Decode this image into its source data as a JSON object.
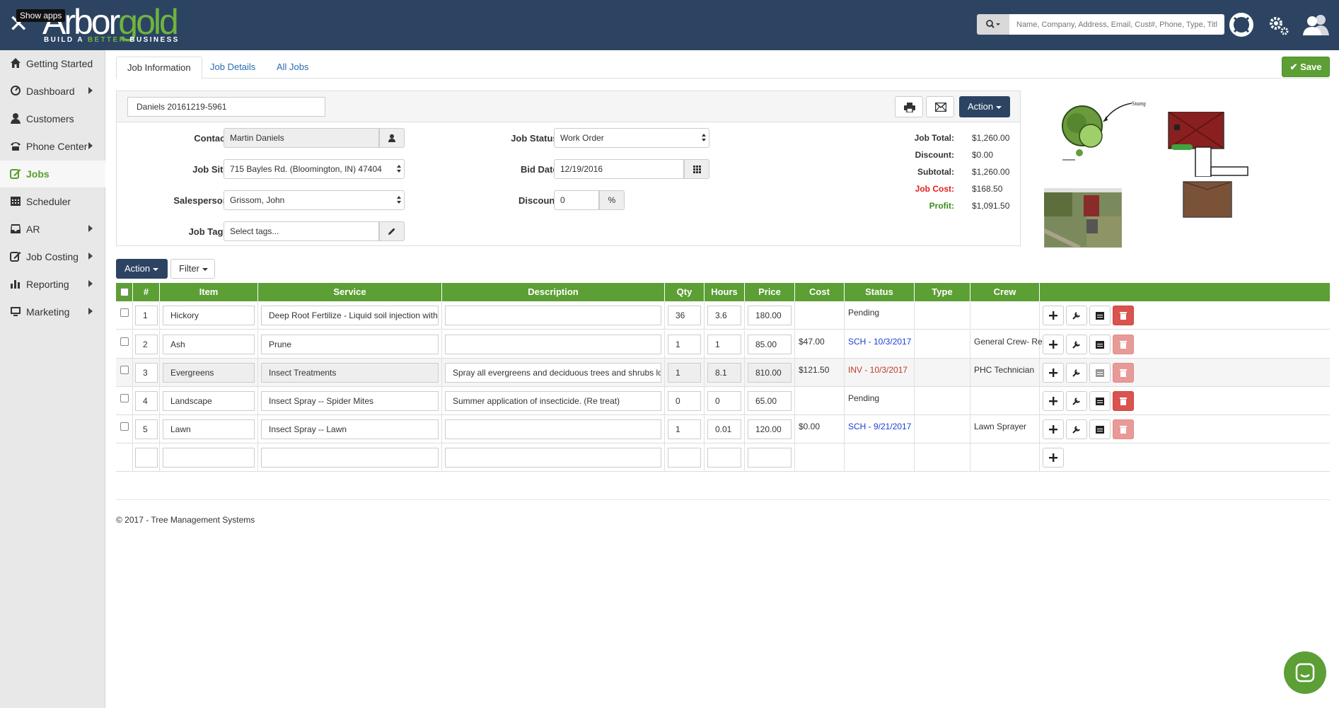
{
  "topbar": {
    "show_apps": "Show apps",
    "logo_main_a": "Arbor",
    "logo_main_b": "gold",
    "logo_tag_a": "BUILD A",
    "logo_tag_b": "BETTER",
    "logo_tag_c": "BUSINESS",
    "search_placeholder": "Name, Company, Address, Email, Cust#, Phone, Type, Title"
  },
  "sidebar": {
    "items": [
      {
        "label": "Getting Started",
        "icon": "home-icon"
      },
      {
        "label": "Dashboard",
        "icon": "dashboard-icon"
      },
      {
        "label": "Customers",
        "icon": "user-icon"
      },
      {
        "label": "Phone Center",
        "icon": "phone-icon"
      },
      {
        "label": "Jobs",
        "icon": "edit-icon"
      },
      {
        "label": "Scheduler",
        "icon": "calendar-icon"
      },
      {
        "label": "AR",
        "icon": "inbox-icon"
      },
      {
        "label": "Job Costing",
        "icon": "edit-icon"
      },
      {
        "label": "Reporting",
        "icon": "bar-chart-icon"
      },
      {
        "label": "Marketing",
        "icon": "monitor-icon"
      }
    ]
  },
  "tabs": [
    "Job Information",
    "Job Details",
    "All Jobs"
  ],
  "save_label": "Save",
  "job": {
    "name": "Daniels 20161219-5961",
    "action_label": "Action",
    "contact_label": "Contact:",
    "contact": "Martin Daniels",
    "site_label": "Job Site:",
    "site": "715 Bayles Rd. (Bloomington, IN) 47404",
    "salesperson_label": "Salesperson:",
    "salesperson": "Grissom, John",
    "tags_label": "Job Tags:",
    "tags_placeholder": "Select tags...",
    "status_label": "Job Status:",
    "status": "Work Order",
    "bid_label": "Bid Date:",
    "bid_date": "12/19/2016",
    "discount_label": "Discount:",
    "discount": "0",
    "discount_unit": "%"
  },
  "totals": {
    "job_total_label": "Job Total:",
    "job_total": "$1,260.00",
    "discount_label": "Discount:",
    "discount": "$0.00",
    "subtotal_label": "Subtotal:",
    "subtotal": "$1,260.00",
    "job_cost_label": "Job Cost:",
    "job_cost": "$168.50",
    "profit_label": "Profit:",
    "profit": "$1,091.50",
    "cost_color": "#e02020",
    "profit_color": "#3a8c1a"
  },
  "sketch": {
    "stump_label": "Stump"
  },
  "toolbar": {
    "action": "Action",
    "filter": "Filter"
  },
  "table": {
    "headers": [
      "#",
      "Item",
      "Service",
      "Description",
      "Qty",
      "Hours",
      "Price",
      "Cost",
      "Status",
      "Type",
      "Crew"
    ],
    "rows": [
      {
        "num": "1",
        "item": "Hickory",
        "service": "Deep Root Fertilize - Liquid soil injection with macro",
        "description": "",
        "qty": "36",
        "hours": "3.6",
        "price": "180.00",
        "cost": "",
        "status": "Pending",
        "type": "",
        "crew": ""
      },
      {
        "num": "2",
        "item": "Ash",
        "service": "Prune",
        "description": "",
        "qty": "1",
        "hours": "1",
        "price": "85.00",
        "cost": "$47.00",
        "status": "SCH - 10/3/2017",
        "type": "",
        "crew": "General Crew- Rex"
      },
      {
        "num": "3",
        "item": "Evergreens",
        "service": "Insect Treatments",
        "description": "Spray all evergreens and deciduous trees and shrubs located ...",
        "qty": "1",
        "hours": "8.1",
        "price": "810.00",
        "cost": "$121.50",
        "status": "INV - 10/3/2017",
        "type": "",
        "crew": "PHC Technician"
      },
      {
        "num": "4",
        "item": "Landscape",
        "service": "Insect Spray -- Spider Mites",
        "description": "Summer application of insecticide. (Re treat)",
        "qty": "0",
        "hours": "0",
        "price": "65.00",
        "cost": "",
        "status": "Pending",
        "type": "",
        "crew": ""
      },
      {
        "num": "5",
        "item": "Lawn",
        "service": "Insect Spray -- Lawn",
        "description": "",
        "qty": "1",
        "hours": "0.01",
        "price": "120.00",
        "cost": "$0.00",
        "status": "SCH - 9/21/2017",
        "type": "",
        "crew": "Lawn Sprayer"
      }
    ]
  },
  "footer": "© 2017 - Tree Management Systems",
  "colors": {
    "navy": "#2c4462",
    "green": "#5b9f35",
    "danger": "#d9534f"
  }
}
